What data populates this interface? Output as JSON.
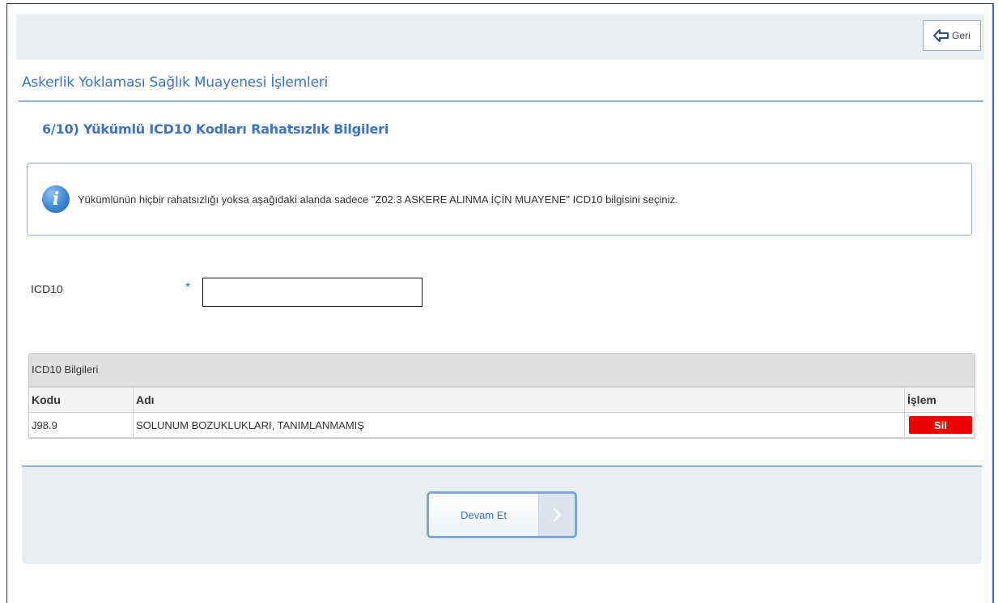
{
  "header": {
    "back_label": "Geri"
  },
  "page": {
    "title": "Askerlik Yoklaması Sağlık Muayenesi İşlemleri",
    "step_title": "6/10) Yükümlü ICD10 Kodları Rahatsızlık Bilgileri"
  },
  "info": {
    "text": "Yükümlünün hiçbir rahatsızlığı yoksa aşağıdaki alanda sadece \"Z02.3 ASKERE ALINMA İÇİN MUAYENE\" ICD10 bilgisini seçiniz."
  },
  "form": {
    "icd_label": "ICD10",
    "required_mark": "*",
    "icd_value": ""
  },
  "grid": {
    "caption": "ICD10 Bilgileri",
    "columns": {
      "code": "Kodu",
      "name": "Adı",
      "action": "İşlem"
    },
    "rows": [
      {
        "code": "J98.9",
        "name": "SOLUNUM BOZUKLUKLARI, TANIMLANMAMIŞ",
        "action_label": "Sil"
      }
    ]
  },
  "footer": {
    "next_label": "Devam Et"
  },
  "colors": {
    "accent": "#3a73c9",
    "danger": "#ee0000",
    "panel": "#eaeef3"
  }
}
